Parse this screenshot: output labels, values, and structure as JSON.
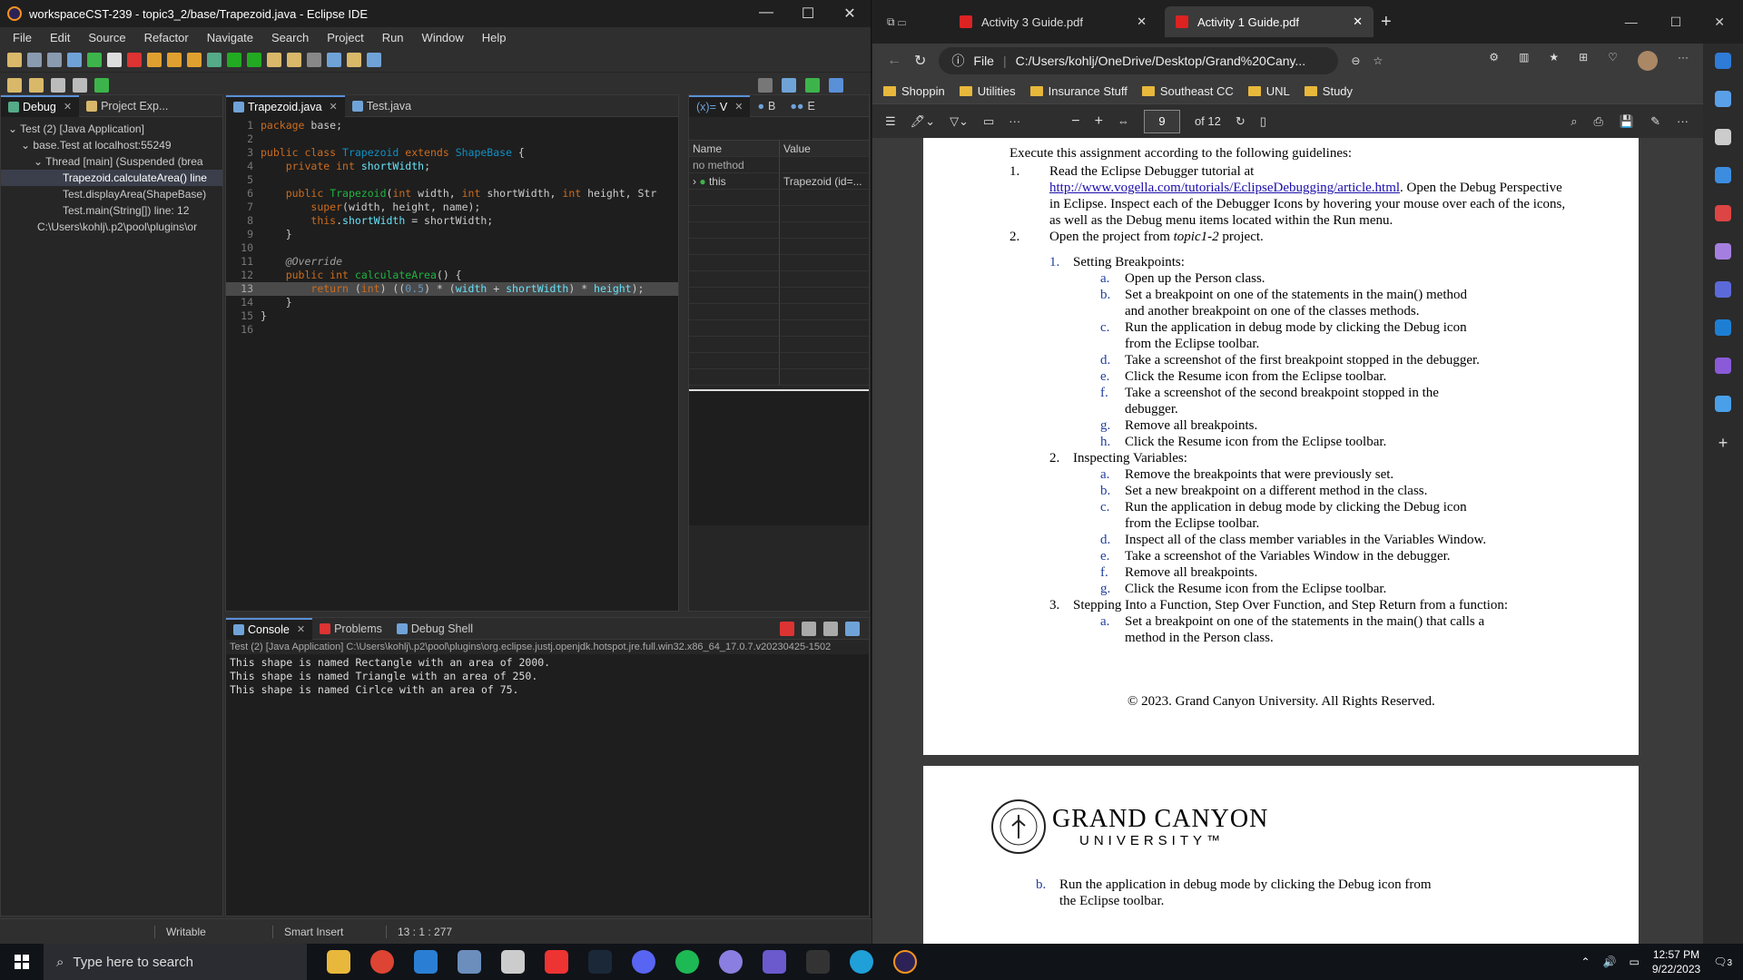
{
  "eclipse": {
    "title": "workspaceCST-239 - topic3_2/base/Trapezoid.java - Eclipse IDE",
    "menu": [
      "File",
      "Edit",
      "Source",
      "Refactor",
      "Navigate",
      "Search",
      "Project",
      "Run",
      "Window",
      "Help"
    ],
    "debug_tabs": [
      "Debug",
      "Project Exp..."
    ],
    "debug_tree": [
      "Test (2) [Java Application]",
      "base.Test at localhost:55249",
      "Thread [main] (Suspended (brea",
      "Trapezoid.calculateArea() line",
      "Test.displayArea(ShapeBase)",
      "Test.main(String[]) line: 12",
      "C:\\Users\\kohlj\\.p2\\pool\\plugins\\or"
    ],
    "editor_tabs": [
      "Trapezoid.java",
      "Test.java"
    ],
    "code_lines": [
      {
        "n": "1",
        "t": "package base;"
      },
      {
        "n": "2",
        "t": ""
      },
      {
        "n": "3",
        "t": "public class Trapezoid extends ShapeBase {"
      },
      {
        "n": "4",
        "t": "    private int shortWidth;"
      },
      {
        "n": "5",
        "t": ""
      },
      {
        "n": "6",
        "t": "    public Trapezoid(int width, int shortWidth, int height, Str"
      },
      {
        "n": "7",
        "t": "        super(width, height, name);"
      },
      {
        "n": "8",
        "t": "        this.shortWidth = shortWidth;"
      },
      {
        "n": "9",
        "t": "    }"
      },
      {
        "n": "10",
        "t": ""
      },
      {
        "n": "11",
        "t": "    @Override"
      },
      {
        "n": "12",
        "t": "    public int calculateArea() {"
      },
      {
        "n": "13",
        "t": "        return (int) ((0.5) * (width + shortWidth) * height);"
      },
      {
        "n": "14",
        "t": "    }"
      },
      {
        "n": "15",
        "t": "}"
      },
      {
        "n": "16",
        "t": ""
      }
    ],
    "vars_tabs": [
      "V",
      "B",
      "E"
    ],
    "vars_columns": [
      "Name",
      "Value"
    ],
    "vars_rows": [
      {
        "name": "no method",
        "value": ""
      },
      {
        "name": "this",
        "value": "Trapezoid  (id=..."
      }
    ],
    "console_tabs": [
      "Console",
      "Problems",
      "Debug Shell"
    ],
    "console_path": "Test (2) [Java Application] C:\\Users\\kohlj\\.p2\\pool\\plugins\\org.eclipse.justj.openjdk.hotspot.jre.full.win32.x86_64_17.0.7.v20230425-1502",
    "console_lines": [
      "This shape is named Rectangle with an area of 2000.",
      "This shape is named Triangle with an area of 250.",
      "This shape is named Cirlce with an area of 75."
    ],
    "status": {
      "writable": "Writable",
      "insert": "Smart Insert",
      "pos": "13 : 1 : 277"
    }
  },
  "edge": {
    "tabs": [
      "Activity 3 Guide.pdf",
      "Activity 1 Guide.pdf"
    ],
    "address_prefix": "File",
    "address": "C:/Users/kohlj/OneDrive/Desktop/Grand%20Cany...",
    "bookmarks": [
      "Shoppin",
      "Utilities",
      "Insurance Stuff",
      "Southeast CC",
      "UNL",
      "Study"
    ],
    "page_num": "9",
    "page_total": "of 12",
    "pdf": {
      "intro": "Execute this assignment according to the following guidelines:",
      "item1_a": "Read the Eclipse Debugger tutorial at",
      "item1_link": "http://www.vogella.com/tutorials/EclipseDebugging/article.html",
      "item1_b": ". Open the Debug Perspective in Eclipse. Inspect each of the Debugger Icons by hovering your mouse over each of the icons, as well as the Debug menu items located within the Run menu.",
      "item2_a": "Open the project from ",
      "item2_it": "topic1-2",
      "item2_b": " project.",
      "sec1": "Setting Breakpoints:",
      "sec1_items": [
        {
          "l": "a.",
          "t": "Open up the Person class."
        },
        {
          "l": "b.",
          "t": "Set a breakpoint on one of the statements in the main() method and another breakpoint on one of the classes methods."
        },
        {
          "l": "c.",
          "t": "Run the application in debug mode by clicking the Debug icon from the Eclipse toolbar."
        },
        {
          "l": "d.",
          "t": "Take a screenshot of the first breakpoint stopped in the debugger."
        },
        {
          "l": "e.",
          "t": "Click the Resume icon from the Eclipse toolbar."
        },
        {
          "l": "f.",
          "t": "Take a screenshot of the second breakpoint stopped in the debugger."
        },
        {
          "l": "g.",
          "t": "Remove all breakpoints."
        },
        {
          "l": "h.",
          "t": "Click the Resume icon from the Eclipse toolbar."
        }
      ],
      "sec2": "Inspecting Variables:",
      "sec2_items": [
        {
          "l": "a.",
          "t": "Remove the breakpoints that were previously set."
        },
        {
          "l": "b.",
          "t": "Set a new breakpoint on a different method in the class."
        },
        {
          "l": "c.",
          "t": "Run the application in debug mode by clicking the Debug icon from the Eclipse toolbar."
        },
        {
          "l": "d.",
          "t": "Inspect all of the class member variables in the Variables Window."
        },
        {
          "l": "e.",
          "t": "Take a screenshot of the Variables Window in the debugger."
        },
        {
          "l": "f.",
          "t": "Remove all breakpoints."
        },
        {
          "l": "g.",
          "t": "Click the Resume icon from the Eclipse toolbar."
        }
      ],
      "sec3": "Stepping Into a Function, Step Over Function, and Step Return from a function:",
      "sec3_items": [
        {
          "l": "a.",
          "t": "Set a breakpoint on one of the statements in the main() that calls a method in the Person class."
        }
      ],
      "copyright": "© 2023. Grand Canyon University. All Rights Reserved.",
      "logo_top": "GRAND CANYON",
      "logo_bottom": "UNIVERSITY™",
      "page2_item": {
        "l": "b.",
        "t": "Run the application in debug mode by clicking the Debug icon from the Eclipse toolbar."
      }
    }
  },
  "taskbar": {
    "search_placeholder": "Type here to search",
    "time": "12:57 PM",
    "date": "9/22/2023",
    "notif_count": "3"
  }
}
